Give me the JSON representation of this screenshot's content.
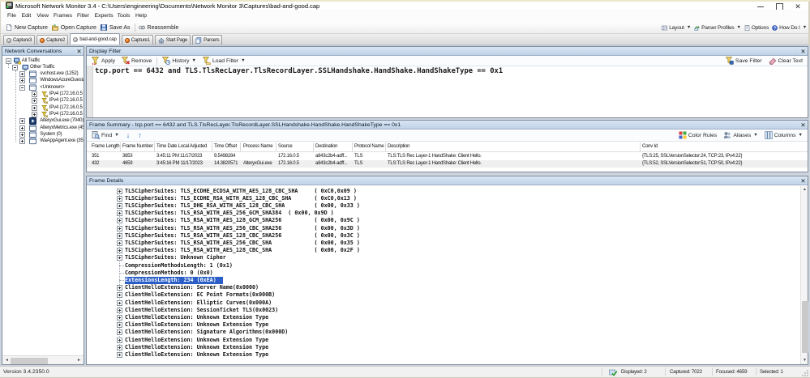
{
  "window": {
    "title": "Microsoft Network Monitor 3.4 - C:\\Users\\engineering\\Documents\\Network Monitor 3\\Captures\\bad-and-good.cap"
  },
  "menu": {
    "items": [
      "File",
      "Edit",
      "View",
      "Frames",
      "Filter",
      "Experts",
      "Tools",
      "Help"
    ]
  },
  "toolbar": {
    "left": [
      {
        "label": "New Capture",
        "icon": "new-capture-icon"
      },
      {
        "label": "Open Capture",
        "icon": "open-capture-icon"
      },
      {
        "label": "Save As",
        "icon": "save-as-icon"
      },
      {
        "label": "Reassemble",
        "icon": "reassemble-icon",
        "sep_before": true
      }
    ],
    "right": [
      {
        "label": "Layout",
        "icon": "layout-icon",
        "dropdown": true
      },
      {
        "label": "Parser Profiles",
        "icon": "parser-profiles-icon",
        "dropdown": true
      },
      {
        "label": "Options",
        "icon": "options-icon"
      },
      {
        "label": "How Do I",
        "icon": "how-do-i-icon",
        "dropdown": true
      }
    ]
  },
  "tabs": [
    {
      "label": "Capture3",
      "icon": "capture-gray",
      "active": false
    },
    {
      "label": "Capture2",
      "icon": "capture-orange",
      "active": false
    },
    {
      "label": "bad-and-good.cap",
      "icon": "capture-gray",
      "active": true
    },
    {
      "label": "Capture1",
      "icon": "capture-orange",
      "active": false
    },
    {
      "label": "Start Page",
      "icon": "home",
      "active": false
    },
    {
      "label": "Parsers",
      "icon": "parsers",
      "active": false
    }
  ],
  "conversations": {
    "title": "Network Conversations",
    "tree": [
      {
        "label": "All Traffic",
        "level": 0,
        "icon": "all-traffic",
        "expander": "minus"
      },
      {
        "label": "Other Traffic",
        "level": 1,
        "icon": "computer",
        "expander": "minus"
      },
      {
        "label": "svchost.exe (1252)",
        "level": 2,
        "icon": "window",
        "expander": "plus"
      },
      {
        "label": "WindowsAzureGuestA",
        "level": 2,
        "icon": "window",
        "expander": "plus"
      },
      {
        "label": "<Unknown>",
        "level": 2,
        "icon": "window",
        "expander": "minus"
      },
      {
        "label": "IPv4 (172.16.0.5 - 1",
        "level": 3,
        "icon": "ipv4",
        "expander": "plus"
      },
      {
        "label": "IPv4 (172.16.0.5 - 1",
        "level": 3,
        "icon": "ipv4",
        "expander": "plus"
      },
      {
        "label": "IPv4 (172.16.0.5 - 1",
        "level": 3,
        "icon": "ipv4",
        "expander": "plus"
      },
      {
        "label": "IPv4 (172.16.0.5 - 1",
        "level": 3,
        "icon": "ipv4",
        "expander": "plus"
      },
      {
        "label": "AlteryxGui.exe (7040)",
        "level": 2,
        "icon": "app",
        "expander": "plus"
      },
      {
        "label": "AlteryxMetrics.exe (45",
        "level": 2,
        "icon": "window",
        "expander": "plus"
      },
      {
        "label": "System (0)",
        "level": 2,
        "icon": "window",
        "expander": "plus"
      },
      {
        "label": "WaAppAgent.exe (352",
        "level": 2,
        "icon": "window",
        "expander": "plus"
      }
    ]
  },
  "display_filter": {
    "title": "Display Filter",
    "buttons_left": [
      {
        "label": "Apply",
        "icon": "apply-filter-icon"
      },
      {
        "label": "Remove",
        "icon": "remove-filter-icon",
        "sep_after": true
      },
      {
        "label": "History",
        "icon": "history-icon",
        "dropdown": true
      },
      {
        "label": "Load Filter",
        "icon": "load-filter-icon",
        "dropdown": true
      }
    ],
    "buttons_right": [
      {
        "label": "Save Filter",
        "icon": "save-filter-icon"
      },
      {
        "label": "Clear Text",
        "icon": "clear-text-icon"
      }
    ],
    "query": "tcp.port == 6432 and TLS.TlsRecLayer.TlsRecordLayer.SSLHandshake.HandShake.HandShakeType == 0x1"
  },
  "frame_summary": {
    "title": "Frame Summary - tcp.port == 6432 and TLS.TlsRecLayer.TlsRecordLayer.SSLHandshake.HandShake.HandShakeType == 0x1",
    "toolbar": {
      "find": "Find",
      "color_rules": "Color Rules",
      "aliases": "Aliases",
      "columns": "Columns"
    },
    "columns": [
      "Frame Length",
      "Frame Number",
      "Time Date Local Adjusted",
      "Time Offset",
      "Process Name",
      "Source",
      "Destination",
      "Protocol Name",
      "Description",
      "Conv Id"
    ],
    "rows": [
      [
        "351",
        "3653",
        "3:45:11 PM 11/17/2023",
        "9.5498284",
        "",
        "172.16.0.5",
        "a843c2b4-adff...",
        "TLS",
        "TLS:TLS Rec Layer-1 HandShake: Client Hello.",
        "{TLS:25, SSLVersionSelector:24, TCP:23, IPv4:22}"
      ],
      [
        "432",
        "4659",
        "3:45:16 PM 11/17/2023",
        "14.3820571",
        "AlteryxGui.exe",
        "172.16.0.5",
        "a843c2b4-adff...",
        "TLS",
        "TLS:TLS Rec Layer-1 HandShake: Client Hello.",
        "{TLS:52, SSLVersionSelector:51, TCP:50, IPv4:22}"
      ]
    ]
  },
  "frame_details": {
    "title": "Frame Details",
    "lines": [
      {
        "expander": "plus",
        "text": "TLSCipherSuites: TLS_ECDHE_ECDSA_WITH_AES_128_CBC_SHA     ( 0xC0,0x09 )"
      },
      {
        "expander": "plus",
        "text": "TLSCipherSuites: TLS_ECDHE_RSA_WITH_AES_128_CBC_SHA       ( 0xC0,0x13 )"
      },
      {
        "expander": "plus",
        "text": "TLSCipherSuites: TLS_DHE_RSA_WITH_AES_128_CBC_SHA         ( 0x00, 0x33 )"
      },
      {
        "expander": "plus",
        "text": "TLSCipherSuites: TLS_RSA_WITH_AES_256_GCM_SHA384  ( 0x00, 0x9D )"
      },
      {
        "expander": "plus",
        "text": "TLSCipherSuites: TLS_RSA_WITH_AES_128_GCM_SHA256          ( 0x00, 0x9C )"
      },
      {
        "expander": "plus",
        "text": "TLSCipherSuites: TLS_RSA_WITH_AES_256_CBC_SHA256          ( 0x00, 0x3D )"
      },
      {
        "expander": "plus",
        "text": "TLSCipherSuites: TLS_RSA_WITH_AES_128_CBC_SHA256          ( 0x00, 0x3C )"
      },
      {
        "expander": "plus",
        "text": "TLSCipherSuites: TLS_RSA_WITH_AES_256_CBC_SHA             ( 0x00, 0x35 )"
      },
      {
        "expander": "plus",
        "text": "TLSCipherSuites: TLS_RSA_WITH_AES_128_CBC_SHA             ( 0x00, 0x2F )"
      },
      {
        "expander": "plus",
        "text": "TLSCipherSuites: Unknown Cipher"
      },
      {
        "expander": "dash",
        "text": "CompressionMethodsLength: 1 (0x1)"
      },
      {
        "expander": "dash",
        "text": "CompressionMethods: 0 (0x0)"
      },
      {
        "expander": "dash",
        "text": "ExtensionsLength: 234 (0xEA)",
        "selected": true
      },
      {
        "expander": "plus",
        "text": "ClientHelloExtension: Server Name(0x0000)"
      },
      {
        "expander": "plus",
        "text": "ClientHelloExtension: EC Point Formats(0x000B)"
      },
      {
        "expander": "plus",
        "text": "ClientHelloExtension: Elliptic Curves(0x000A)"
      },
      {
        "expander": "plus",
        "text": "ClientHelloExtension: SessionTicket TLS(0x0023)"
      },
      {
        "expander": "plus",
        "text": "ClientHelloExtension: Unknown Extension Type"
      },
      {
        "expander": "plus",
        "text": "ClientHelloExtension: Unknown Extension Type"
      },
      {
        "expander": "plus",
        "text": "ClientHelloExtension: Signature Algorithms(0x000D)"
      },
      {
        "expander": "plus",
        "text": "ClientHelloExtension: Unknown Extension Type"
      },
      {
        "expander": "plus",
        "text": "ClientHelloExtension: Unknown Extension Type"
      },
      {
        "expander": "plus",
        "text": "ClientHelloExtension: Unknown Extension Type"
      }
    ]
  },
  "status": {
    "version": "Version 3.4.2350.0",
    "displayed": "Displayed: 2",
    "captured": "Captured: 7022",
    "focused": "Focused: 4659",
    "selected": "Selected: 1"
  },
  "glyphs": {
    "dropdown": "▼",
    "close": "✕",
    "scroll_left": "◄",
    "scroll_right": "►",
    "scroll_up": "▲",
    "scroll_down": "▼",
    "find_down": "↓",
    "find_up": "↑"
  },
  "colors": {
    "selection": "#2b5fc7",
    "panel_header": "#c9daec",
    "workspace": "#ccd4de"
  }
}
